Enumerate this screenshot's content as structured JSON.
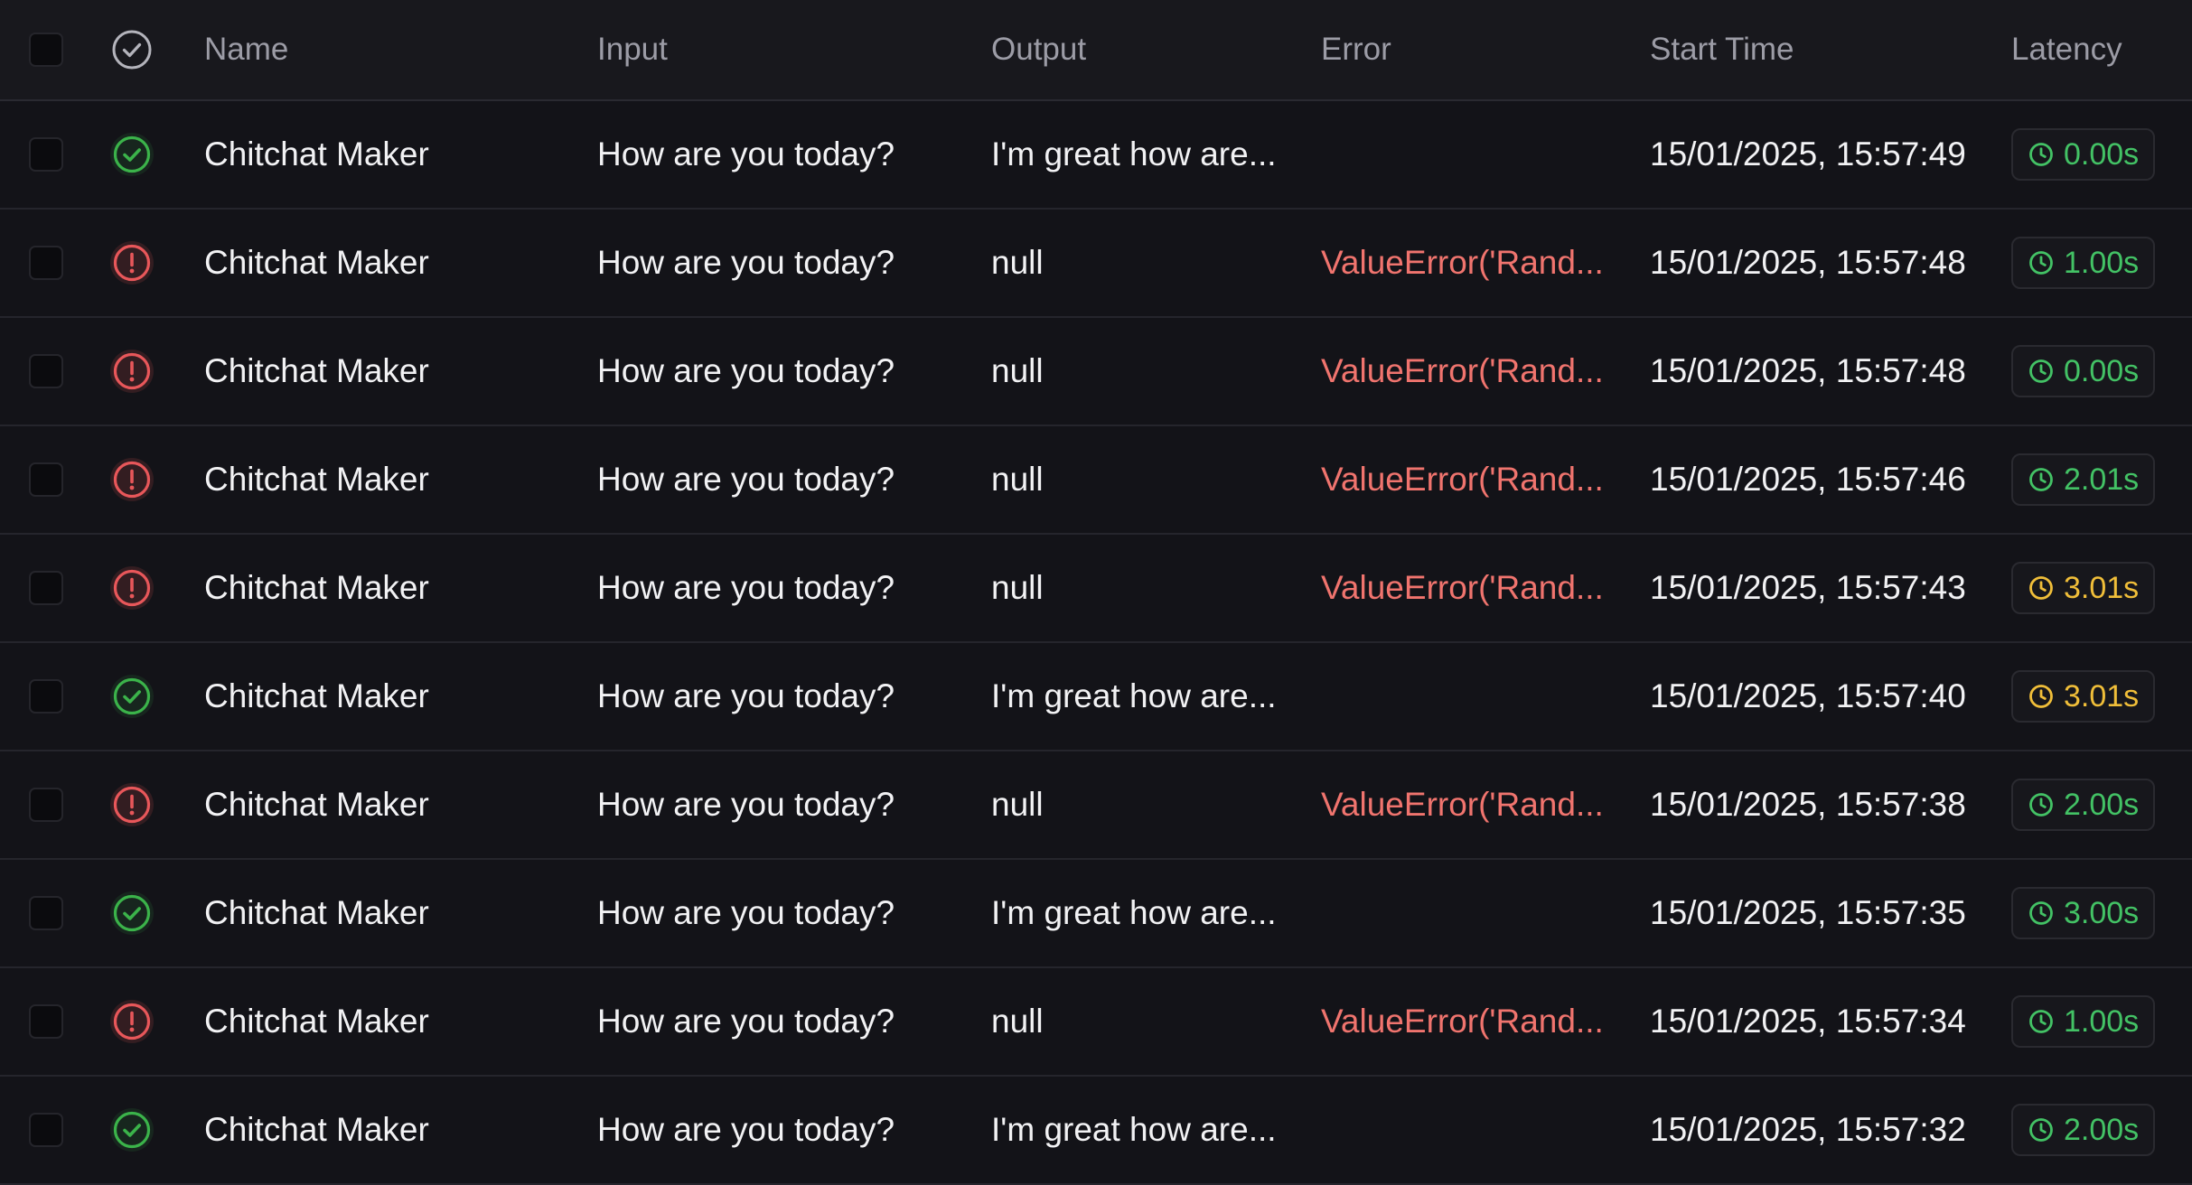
{
  "columns": {
    "name": "Name",
    "input": "Input",
    "output": "Output",
    "error": "Error",
    "start_time": "Start Time",
    "latency": "Latency"
  },
  "colors": {
    "success": "#3bb34a",
    "error": "#e8575a",
    "latency_green": "#43c265",
    "latency_yellow": "#f0be39"
  },
  "rows": [
    {
      "status": "success",
      "status_icon": "check-circle-icon",
      "name": "Chitchat Maker",
      "input": "How are you today?",
      "output": "I'm great how are...",
      "error": "",
      "start_time": "15/01/2025, 15:57:49",
      "latency": "0.00s",
      "latency_level": "green"
    },
    {
      "status": "error",
      "status_icon": "alert-circle-icon",
      "name": "Chitchat Maker",
      "input": "How are you today?",
      "output": "null",
      "error": "ValueError('Rand...",
      "start_time": "15/01/2025, 15:57:48",
      "latency": "1.00s",
      "latency_level": "green"
    },
    {
      "status": "error",
      "status_icon": "alert-circle-icon",
      "name": "Chitchat Maker",
      "input": "How are you today?",
      "output": "null",
      "error": "ValueError('Rand...",
      "start_time": "15/01/2025, 15:57:48",
      "latency": "0.00s",
      "latency_level": "green"
    },
    {
      "status": "error",
      "status_icon": "alert-circle-icon",
      "name": "Chitchat Maker",
      "input": "How are you today?",
      "output": "null",
      "error": "ValueError('Rand...",
      "start_time": "15/01/2025, 15:57:46",
      "latency": "2.01s",
      "latency_level": "green"
    },
    {
      "status": "error",
      "status_icon": "alert-circle-icon",
      "name": "Chitchat Maker",
      "input": "How are you today?",
      "output": "null",
      "error": "ValueError('Rand...",
      "start_time": "15/01/2025, 15:57:43",
      "latency": "3.01s",
      "latency_level": "yellow"
    },
    {
      "status": "success",
      "status_icon": "check-circle-icon",
      "name": "Chitchat Maker",
      "input": "How are you today?",
      "output": "I'm great how are...",
      "error": "",
      "start_time": "15/01/2025, 15:57:40",
      "latency": "3.01s",
      "latency_level": "yellow"
    },
    {
      "status": "error",
      "status_icon": "alert-circle-icon",
      "name": "Chitchat Maker",
      "input": "How are you today?",
      "output": "null",
      "error": "ValueError('Rand...",
      "start_time": "15/01/2025, 15:57:38",
      "latency": "2.00s",
      "latency_level": "green"
    },
    {
      "status": "success",
      "status_icon": "check-circle-icon",
      "name": "Chitchat Maker",
      "input": "How are you today?",
      "output": "I'm great how are...",
      "error": "",
      "start_time": "15/01/2025, 15:57:35",
      "latency": "3.00s",
      "latency_level": "green"
    },
    {
      "status": "error",
      "status_icon": "alert-circle-icon",
      "name": "Chitchat Maker",
      "input": "How are you today?",
      "output": "null",
      "error": "ValueError('Rand...",
      "start_time": "15/01/2025, 15:57:34",
      "latency": "1.00s",
      "latency_level": "green"
    },
    {
      "status": "success",
      "status_icon": "check-circle-icon",
      "name": "Chitchat Maker",
      "input": "How are you today?",
      "output": "I'm great how are...",
      "error": "",
      "start_time": "15/01/2025, 15:57:32",
      "latency": "2.00s",
      "latency_level": "green"
    }
  ]
}
